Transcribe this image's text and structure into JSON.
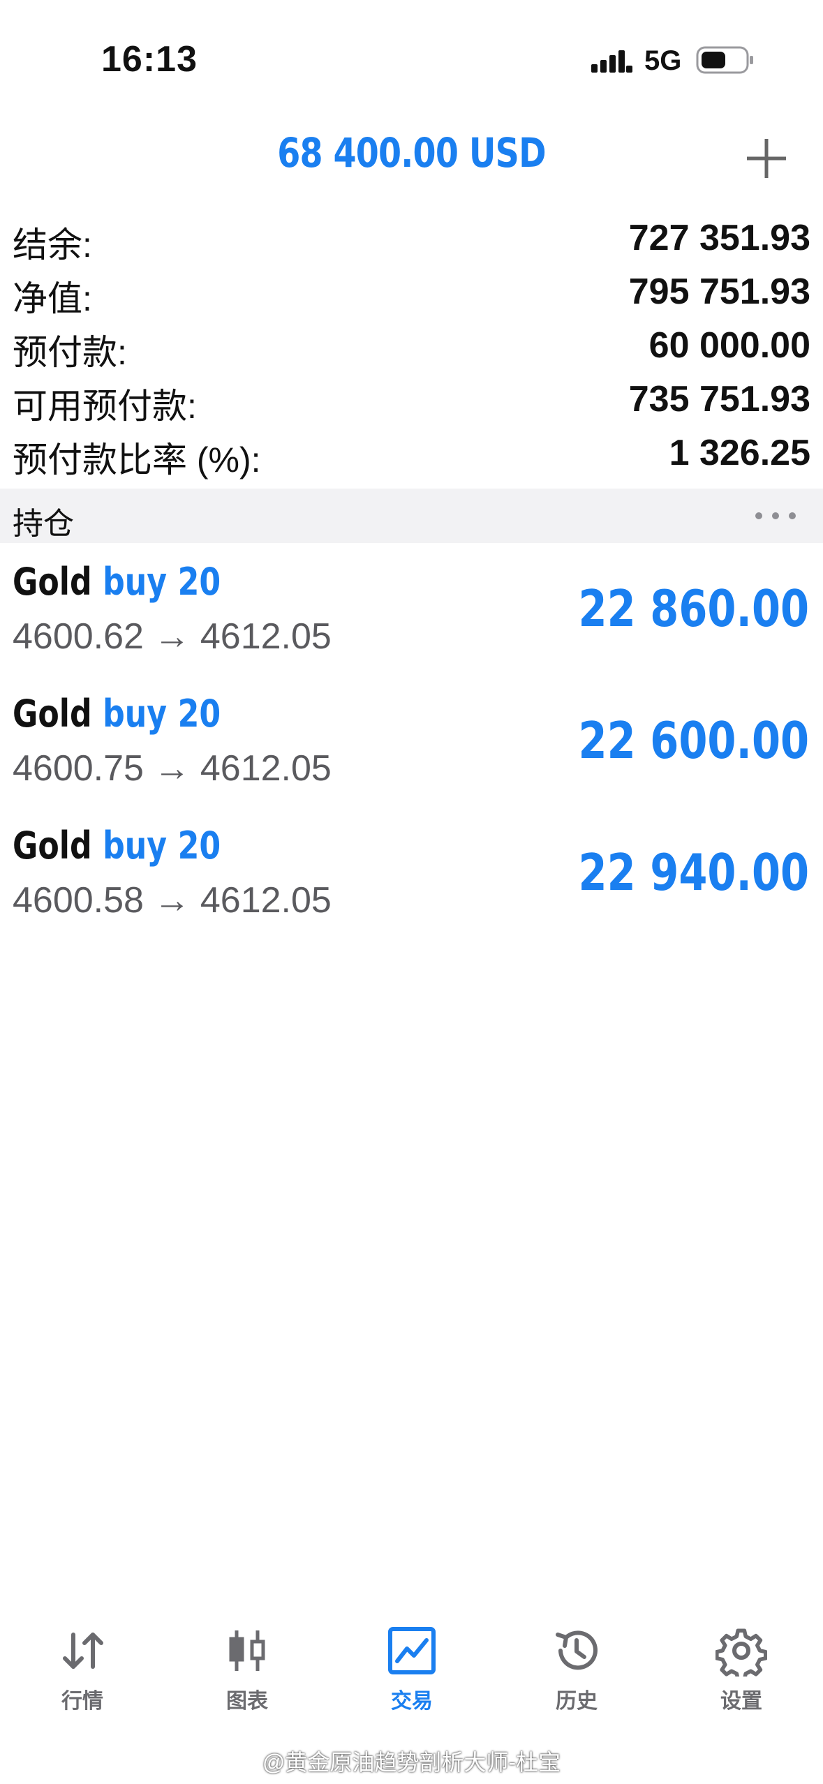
{
  "status_bar": {
    "time": "16:13",
    "network": "5G",
    "icons": [
      "signal-icon",
      "battery-icon"
    ]
  },
  "header": {
    "title": "68 400.00 USD",
    "add_icon": "plus-icon"
  },
  "summary": [
    {
      "label": "结余:",
      "value": "727 351.93"
    },
    {
      "label": "净值:",
      "value": "795 751.93"
    },
    {
      "label": "预付款:",
      "value": "60 000.00"
    },
    {
      "label": "可用预付款:",
      "value": "735 751.93"
    },
    {
      "label": "预付款比率 (%):",
      "value": "1 326.25"
    }
  ],
  "positions_section": {
    "title": "持仓",
    "more_icon": "more-dots-icon"
  },
  "positions": [
    {
      "symbol": "Gold",
      "type": "buy 20",
      "open_price": "4600.62",
      "arrow": "→",
      "current_price": "4612.05",
      "profit": "22 860.00"
    },
    {
      "symbol": "Gold",
      "type": "buy 20",
      "open_price": "4600.75",
      "arrow": "→",
      "current_price": "4612.05",
      "profit": "22 600.00"
    },
    {
      "symbol": "Gold",
      "type": "buy 20",
      "open_price": "4600.58",
      "arrow": "→",
      "current_price": "4612.05",
      "profit": "22 940.00"
    }
  ],
  "tabs": [
    {
      "label": "行情",
      "icon": "quotes-arrows-icon",
      "active": false
    },
    {
      "label": "图表",
      "icon": "candlestick-chart-icon",
      "active": false
    },
    {
      "label": "交易",
      "icon": "trade-chart-icon",
      "active": true
    },
    {
      "label": "历史",
      "icon": "history-clock-icon",
      "active": false
    },
    {
      "label": "设置",
      "icon": "settings-gear-icon",
      "active": false
    }
  ],
  "colors": {
    "accent": "#1a7ff0",
    "text": "#111111",
    "secondary_text": "#5a5a5e",
    "section_bg": "#f2f2f4",
    "inactive_tab": "#6b6b6f"
  },
  "watermark": {
    "text": "@黄金原油趋势剖析大师-杜宝"
  }
}
